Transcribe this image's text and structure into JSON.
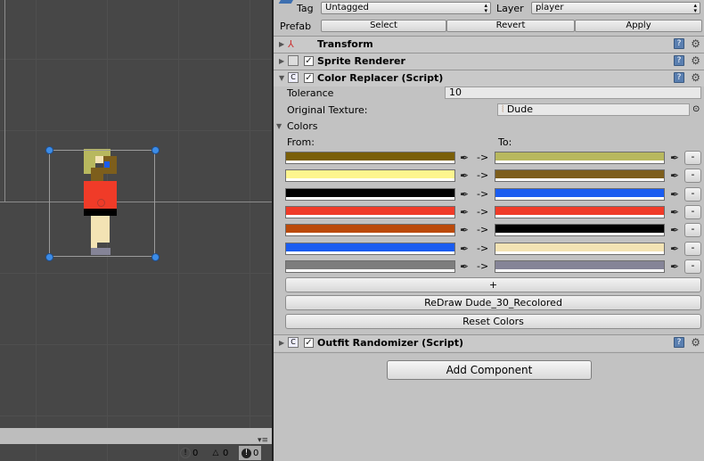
{
  "inspector": {
    "tag_label": "Tag",
    "tag_value": "Untagged",
    "layer_label": "Layer",
    "layer_value": "player",
    "prefab_label": "Prefab",
    "prefab_select": "Select",
    "prefab_revert": "Revert",
    "prefab_apply": "Apply"
  },
  "components": {
    "transform": "Transform",
    "sprite_renderer": "Sprite Renderer",
    "color_replacer": "Color Replacer (Script)",
    "outfit_randomizer": "Outfit Randomizer (Script)"
  },
  "color_replacer": {
    "tolerance_label": "Tolerance",
    "tolerance_value": "10",
    "original_texture_label": "Original Texture:",
    "original_texture_value": "Dude",
    "colors_label": "Colors",
    "from_label": "From:",
    "to_label": "To:",
    "arrow": "->",
    "remove_label": "-",
    "pairs": [
      {
        "from": "#7a5f08",
        "to": "#b8b85e"
      },
      {
        "from": "#fdf58e",
        "to": "#7d5e1c"
      },
      {
        "from": "#000000",
        "to": "#1a5cf0"
      },
      {
        "from": "#f03b28",
        "to": "#f03b28"
      },
      {
        "from": "#bb4a0a",
        "to": "#000000"
      },
      {
        "from": "#1a5cf0",
        "to": "#f3e3b4"
      },
      {
        "from": "#7d7d7d",
        "to": "#858497"
      }
    ],
    "add_label": "+",
    "redraw_label": "ReDraw Dude_30_Recolored",
    "reset_label": "Reset Colors"
  },
  "add_component_label": "Add Component",
  "console": {
    "info_count": "0",
    "warning_count": "0",
    "error_count": "0"
  },
  "icons": {
    "transform": "axes-icon",
    "sprite_renderer": "sprite-renderer-icon",
    "script": "script-icon",
    "help": "help-book-icon",
    "settings": "gear-icon",
    "picker": "eyedropper-icon"
  }
}
